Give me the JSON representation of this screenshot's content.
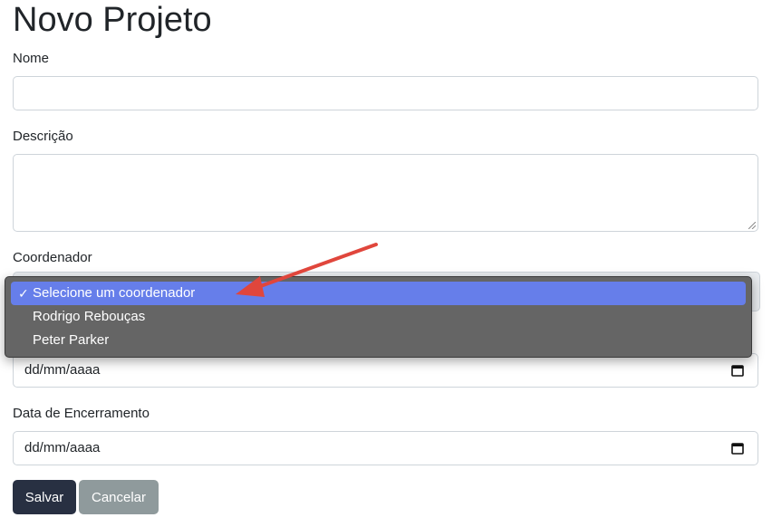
{
  "page": {
    "title": "Novo Projeto"
  },
  "form": {
    "name": {
      "label": "Nome",
      "value": ""
    },
    "description": {
      "label": "Descrição",
      "value": ""
    },
    "coordinator": {
      "label": "Coordenador",
      "selected": "Selecione um coordenador",
      "options": [
        {
          "label": "Selecione um coordenador",
          "checkmark": "✓"
        },
        {
          "label": "Rodrigo Rebouças"
        },
        {
          "label": "Peter Parker"
        }
      ]
    },
    "start_date": {
      "placeholder": "dd/mm/aaaa"
    },
    "end_date": {
      "label": "Data de Encerramento",
      "placeholder": "dd/mm/aaaa"
    }
  },
  "actions": {
    "save_label": "Salvar",
    "cancel_label": "Cancelar"
  },
  "colors": {
    "save_button": "#283042",
    "cancel_button": "#8f9a9c",
    "dropdown_background": "#656565",
    "selected_option": "#667eea",
    "annotation_arrow": "#e0463c"
  },
  "icons": {
    "date_picker": "calendar-icon",
    "selected_option": "checkmark-icon",
    "annotation": "red-arrow-icon"
  }
}
